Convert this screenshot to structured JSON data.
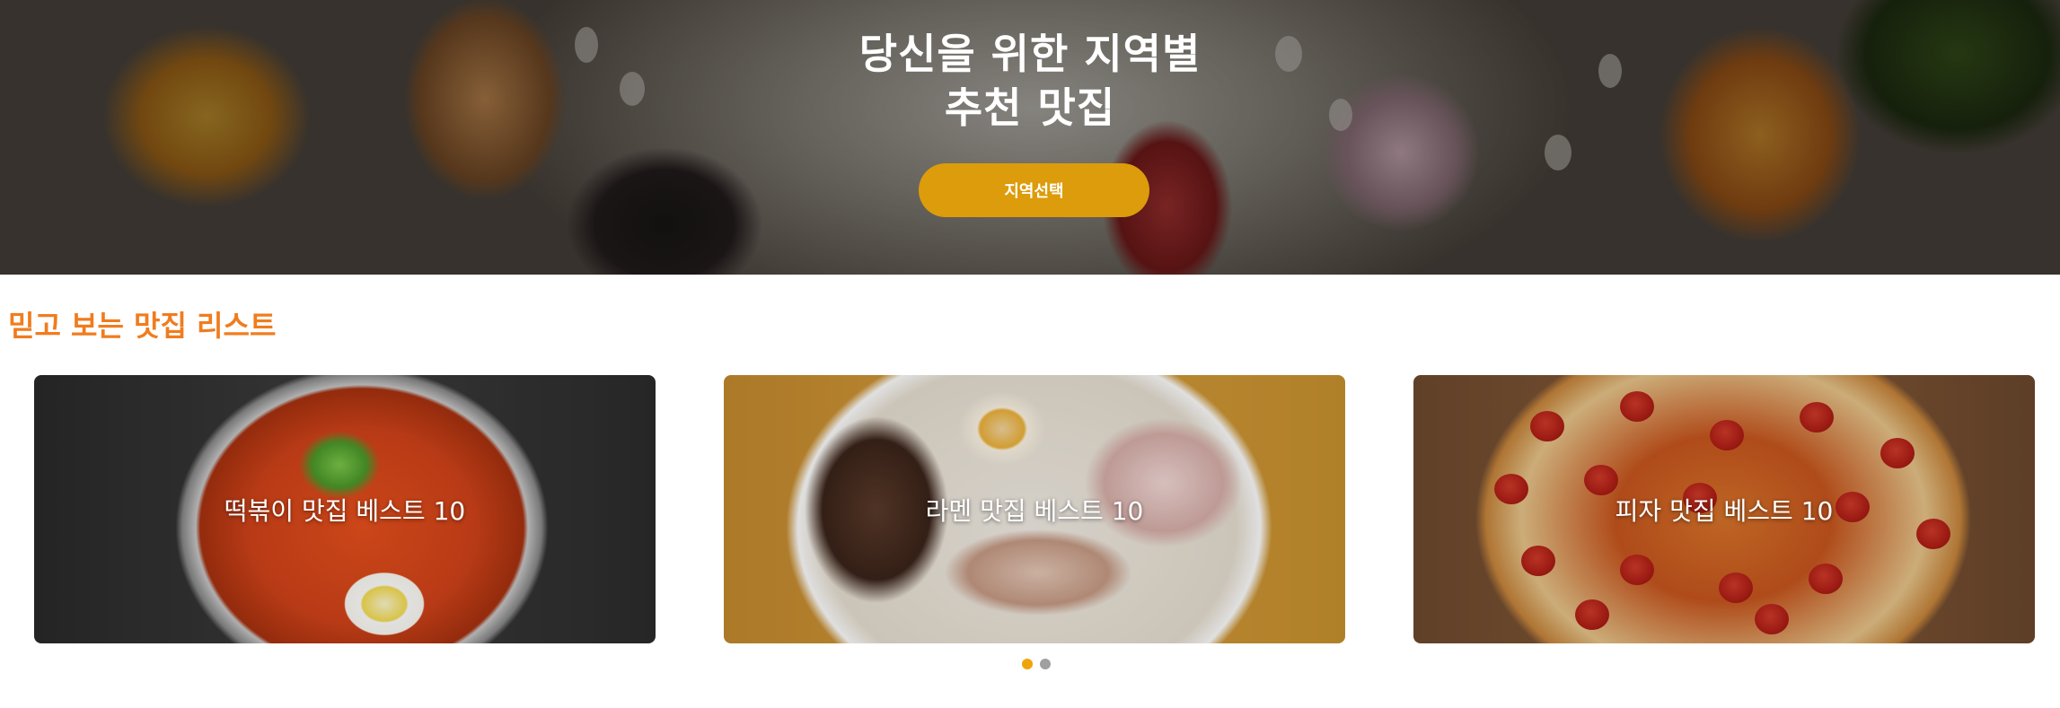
{
  "hero": {
    "title_line1": "당신을 위한 지역별",
    "title_line2": "추천 맛집",
    "region_button": "지역선택"
  },
  "section": {
    "title": "믿고 보는 맛집 리스트"
  },
  "cards": [
    {
      "label": "떡볶이 맛집 베스트 10",
      "image": "tteokbokki"
    },
    {
      "label": "라멘 맛집 베스트 10",
      "image": "ramen"
    },
    {
      "label": "피자 맛집 베스트 10",
      "image": "pizza"
    }
  ],
  "pagination": {
    "pages": 2,
    "active": 1
  },
  "colors": {
    "accent": "#dc9c0b",
    "section_title": "#f07c1e",
    "dot_active": "#f0a40c",
    "dot_inactive": "#a0a0a0"
  }
}
